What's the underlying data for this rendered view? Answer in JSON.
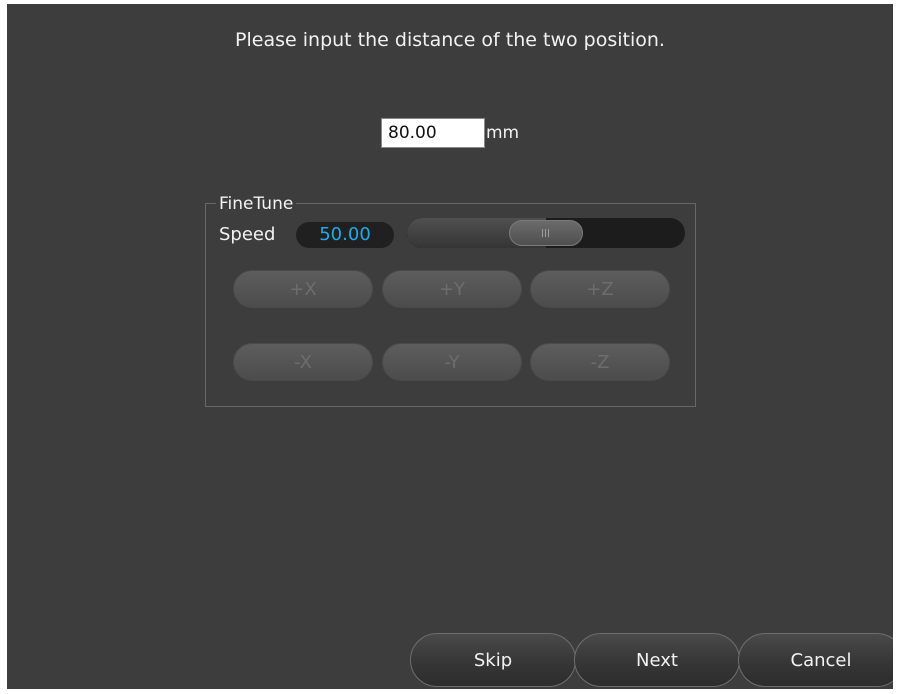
{
  "instruction": "Please input the distance of the two position.",
  "distance": {
    "value": "80.00",
    "unit": "mm"
  },
  "finetune": {
    "title": "FineTune",
    "speed_label": "Speed",
    "speed_value": "50.00",
    "speed_slider_fraction": 0.5,
    "buttons": {
      "plus_x": "+X",
      "plus_y": "+Y",
      "plus_z": "+Z",
      "minus_x": "-X",
      "minus_y": "-Y",
      "minus_z": "-Z"
    }
  },
  "footer": {
    "skip": "Skip",
    "next": "Next",
    "cancel": "Cancel"
  },
  "icons": {
    "slider_handle": "grip-icon"
  },
  "colors": {
    "background": "#3d3d3d",
    "speed_value_text": "#22a9ec",
    "disabled_button_text": "#6d6d6d"
  }
}
